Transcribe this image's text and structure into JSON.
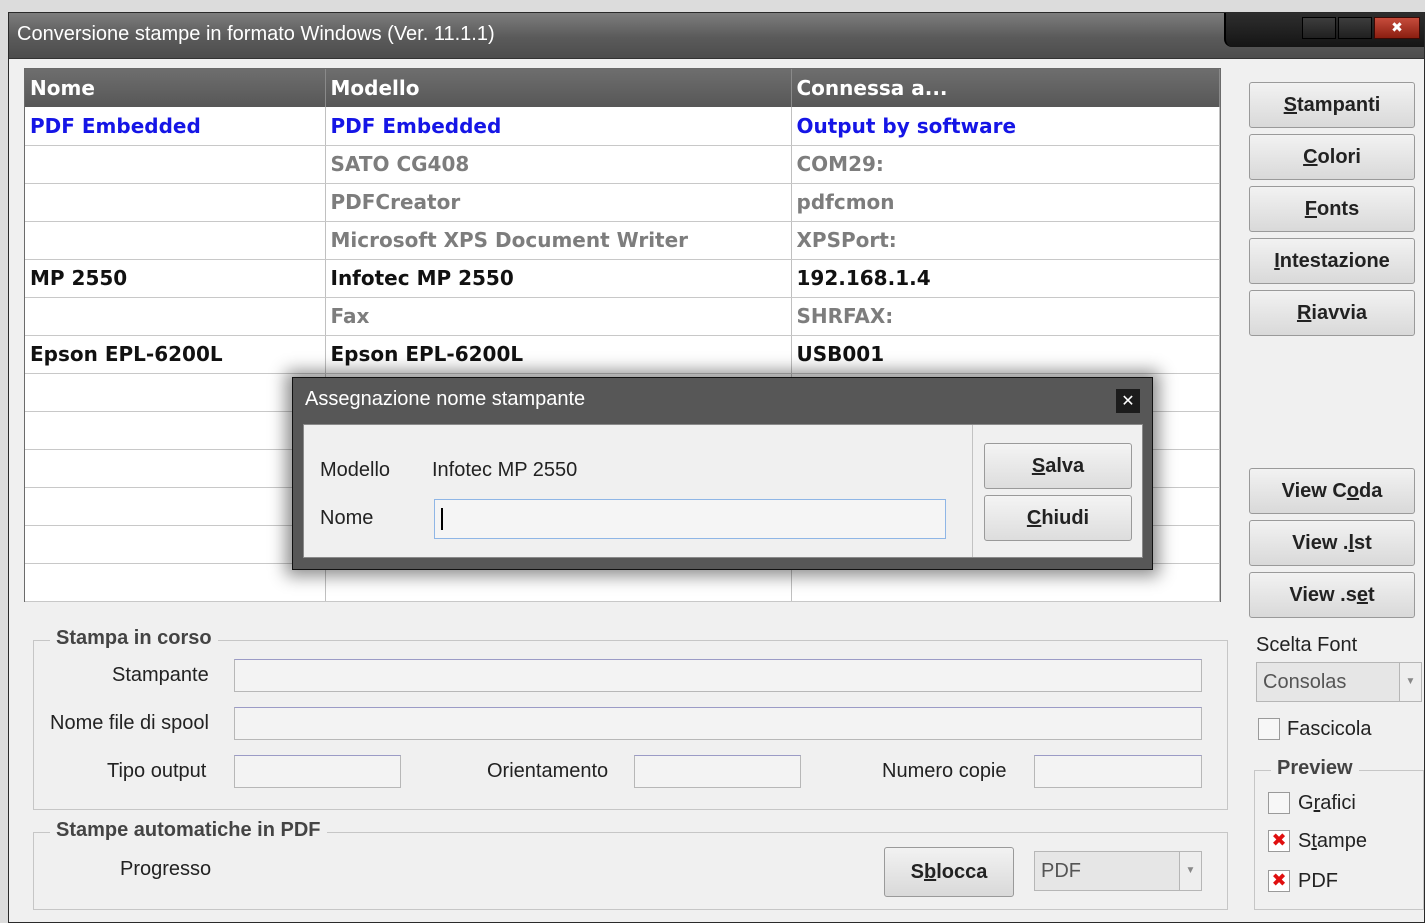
{
  "window": {
    "title": "Conversione stampe in formato Windows (Ver. 11.1.1)",
    "close_glyph": "✖"
  },
  "grid": {
    "columns": [
      "Nome",
      "Modello",
      "Connessa a..."
    ],
    "rows": [
      {
        "nome": "PDF Embedded",
        "modello": "PDF Embedded",
        "connessa": "Output by software",
        "style": "blue"
      },
      {
        "nome": "",
        "modello": "SATO CG408",
        "connessa": "COM29:",
        "style": "gray"
      },
      {
        "nome": "",
        "modello": "PDFCreator",
        "connessa": "pdfcmon",
        "style": "gray"
      },
      {
        "nome": "",
        "modello": "Microsoft XPS Document Writer",
        "connessa": "XPSPort:",
        "style": "gray"
      },
      {
        "nome": "MP 2550",
        "modello": "Infotec MP 2550",
        "connessa": "192.168.1.4",
        "style": "black"
      },
      {
        "nome": "",
        "modello": "Fax",
        "connessa": "SHRFAX:",
        "style": "gray"
      },
      {
        "nome": "Epson EPL-6200L",
        "modello": "Epson EPL-6200L",
        "connessa": "USB001",
        "style": "black"
      }
    ],
    "empty_rows": 6
  },
  "side_buttons": {
    "stampanti": {
      "pre": "",
      "u": "S",
      "post": "tampanti"
    },
    "colori": {
      "pre": "",
      "u": "C",
      "post": "olori"
    },
    "fonts": {
      "pre": "",
      "u": "F",
      "post": "onts"
    },
    "intestazione": {
      "pre": "",
      "u": "I",
      "post": "ntestazione"
    },
    "riavvia": {
      "pre": "",
      "u": "R",
      "post": "iavvia"
    },
    "view_coda": {
      "pre": "View C",
      "u": "o",
      "post": "da"
    },
    "view_lst": {
      "pre": "View .",
      "u": "l",
      "post": "st"
    },
    "view_set": {
      "pre": "View .s",
      "u": "e",
      "post": "t"
    }
  },
  "font_section": {
    "label": "Scelta Font",
    "font_value": "Consolas",
    "fascicola_label": "Fascicola",
    "fascicola_checked": false
  },
  "preview": {
    "title": "Preview",
    "grafici": {
      "pre": "G",
      "u": "r",
      "post": "afici",
      "checked": false
    },
    "stampe": {
      "pre": "S",
      "u": "t",
      "post": "ampe",
      "checked": true
    },
    "pdf": {
      "pre": "PDF",
      "u": "",
      "post": "",
      "checked": true
    },
    "check_mark": "✖"
  },
  "stampa_in_corso": {
    "title": "Stampa in corso",
    "stampante_label": "Stampante",
    "spool_label": "Nome file di spool",
    "tipo_output_label": "Tipo output",
    "orientamento_label": "Orientamento",
    "numero_copie_label": "Numero copie"
  },
  "stampe_auto": {
    "title": "Stampe automatiche in PDF",
    "progresso_label": "Progresso",
    "sblocca": {
      "pre": "S",
      "u": "b",
      "post": "locca"
    },
    "format_value": "PDF"
  },
  "dialog": {
    "title": "Assegnazione nome stampante",
    "close_glyph": "✕",
    "modello_label": "Modello",
    "modello_value": "Infotec MP 2550",
    "nome_label": "Nome",
    "nome_value": "",
    "salva": {
      "pre": "",
      "u": "S",
      "post": "alva"
    },
    "chiudi": {
      "pre": "",
      "u": "C",
      "post": "hiudi"
    }
  },
  "colors": {
    "accent_blue": "#1515e6",
    "gray_text": "#7d7d7d",
    "check_red": "#e01010"
  }
}
